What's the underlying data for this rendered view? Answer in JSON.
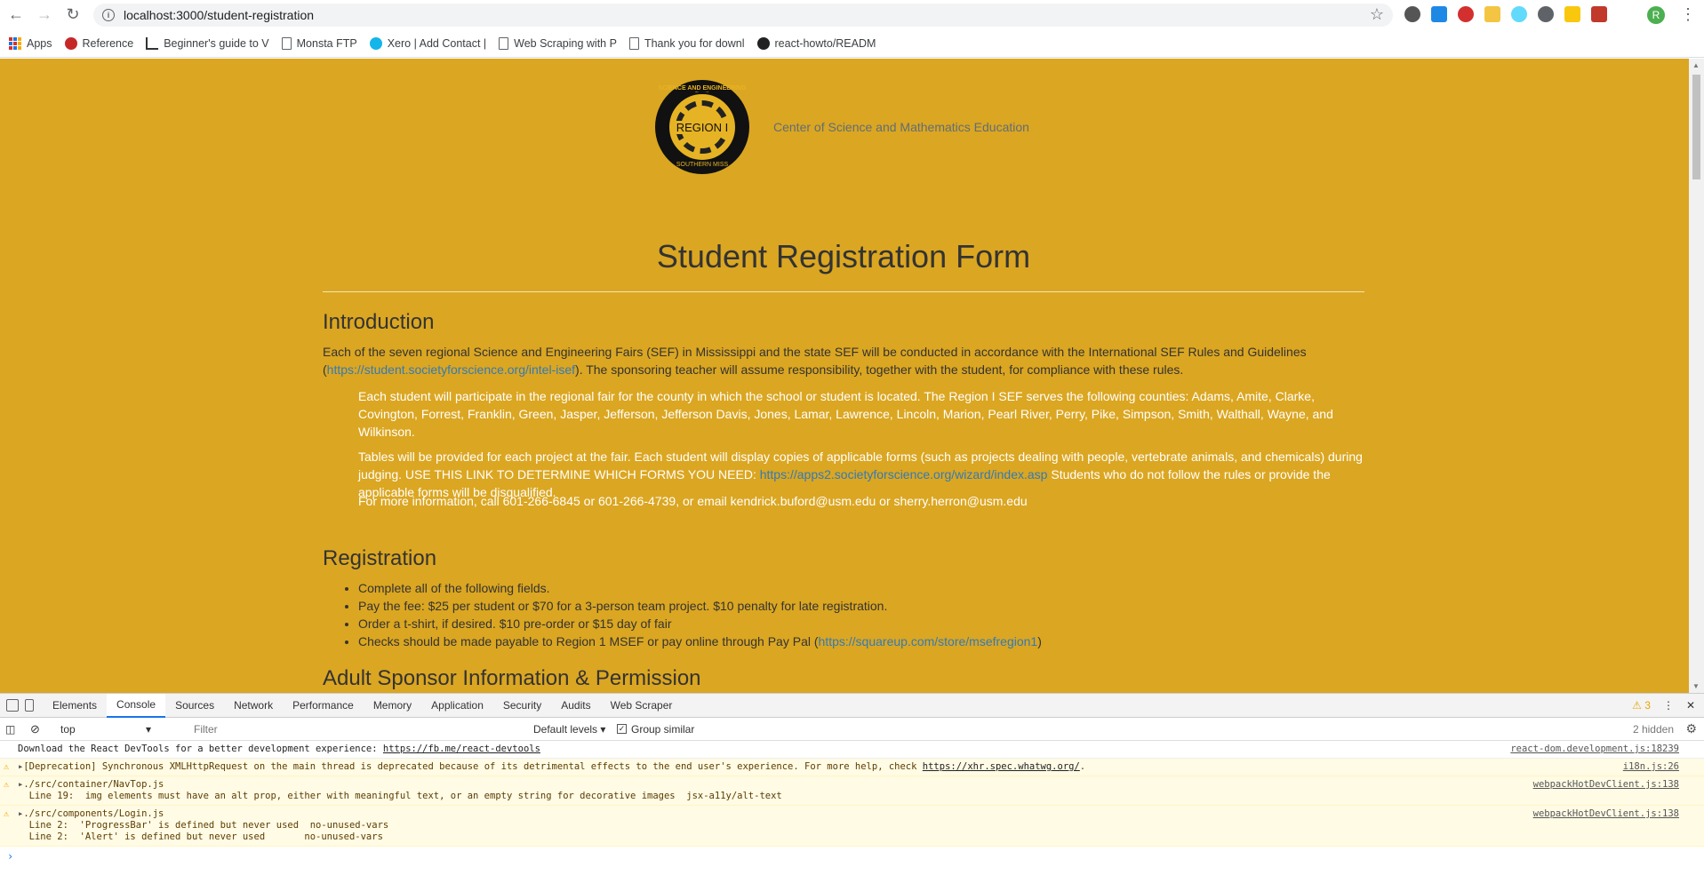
{
  "browser": {
    "url": "localhost:3000/student-registration",
    "profile_initial": "R",
    "bookmarks": [
      {
        "label": "Apps"
      },
      {
        "label": "Reference"
      },
      {
        "label": "Beginner's guide to V"
      },
      {
        "label": "Monsta FTP"
      },
      {
        "label": "Xero | Add Contact |"
      },
      {
        "label": "Web Scraping with P"
      },
      {
        "label": "Thank you for downl"
      },
      {
        "label": "react-howto/READM"
      }
    ]
  },
  "page": {
    "logo_top": "SCIENCE AND ENGINEERING FAIR",
    "logo_region": "REGION I",
    "logo_bottom": "SOUTHERN MISS",
    "center_name": "Center of Science and Mathematics Education",
    "title": "Student Registration Form",
    "intro_heading": "Introduction",
    "intro_p1_a": "Each of the seven regional Science and Engineering Fairs (SEF) in Mississippi and the state SEF will be conducted in accordance with the International SEF Rules and Guidelines (",
    "intro_p1_link": "https://student.societyforscience.org/intel-isef",
    "intro_p1_b": "). The sponsoring teacher will assume responsibility, together with the student, for compliance with these rules.",
    "intro_q1": "Each student will participate in the regional fair for the county in which the school or student is located. The Region I SEF serves the following counties: Adams, Amite, Clarke, Covington, Forrest, Franklin, Green, Jasper, Jefferson, Jefferson Davis, Jones, Lamar, Lawrence, Lincoln, Marion, Pearl River, Perry, Pike, Simpson, Smith, Walthall, Wayne, and Wilkinson.",
    "intro_q2_a": "Tables will be provided for each project at the fair. Each student will display copies of applicable forms (such as projects dealing with people, vertebrate animals, and chemicals) during judging. USE THIS LINK TO DETERMINE WHICH FORMS YOU NEED: ",
    "intro_q2_link": "https://apps2.societyforscience.org/wizard/index.asp",
    "intro_q2_b": " Students who do not follow the rules or provide the applicable forms will be disqualified.",
    "intro_q3": "For more information, call 601-266-6845 or 601-266-4739, or email kendrick.buford@usm.edu or sherry.herron@usm.edu",
    "reg_heading": "Registration",
    "reg_items": [
      "Complete all of the following fields.",
      "Pay the fee: $25 per student or $70 for a 3-person team project. $10 penalty for late registration.",
      "Order a t-shirt, if desired. $10 pre-order or $15 day of fair"
    ],
    "reg_item4_a": "Checks should be made payable to Region 1 MSEF or pay online through Pay Pal (",
    "reg_item4_link": "https://squareup.com/store/msefregion1",
    "reg_item4_b": ")",
    "sponsor_heading": "Adult Sponsor Information & Permission"
  },
  "devtools": {
    "tabs": [
      "Elements",
      "Console",
      "Sources",
      "Network",
      "Performance",
      "Memory",
      "Application",
      "Security",
      "Audits",
      "Web Scraper"
    ],
    "active_tab": "Console",
    "warning_count": "3",
    "context": "top",
    "filter_placeholder": "Filter",
    "levels": "Default levels",
    "group_similar": "Group similar",
    "hidden": "2 hidden",
    "messages": [
      {
        "text": "Download the React DevTools for a better development experience: ",
        "link": "https://fb.me/react-devtools",
        "source": "react-dom.development.js:18239"
      },
      {
        "text": "[Deprecation] Synchronous XMLHttpRequest on the main thread is deprecated because of its detrimental effects to the end user's experience. For more help, check ",
        "link": "https://xhr.spec.whatwg.org/",
        "tail": ".",
        "source": "i18n.js:26"
      },
      {
        "text": "./src/container/NavTop.js\n  Line 19:  img elements must have an alt prop, either with meaningful text, or an empty string for decorative images  jsx-a11y/alt-text",
        "source": "webpackHotDevClient.js:138"
      },
      {
        "text": "./src/components/Login.js\n  Line 2:  'ProgressBar' is defined but never used  no-unused-vars\n  Line 2:  'Alert' is defined but never used       no-unused-vars",
        "source": "webpackHotDevClient.js:138"
      }
    ]
  }
}
